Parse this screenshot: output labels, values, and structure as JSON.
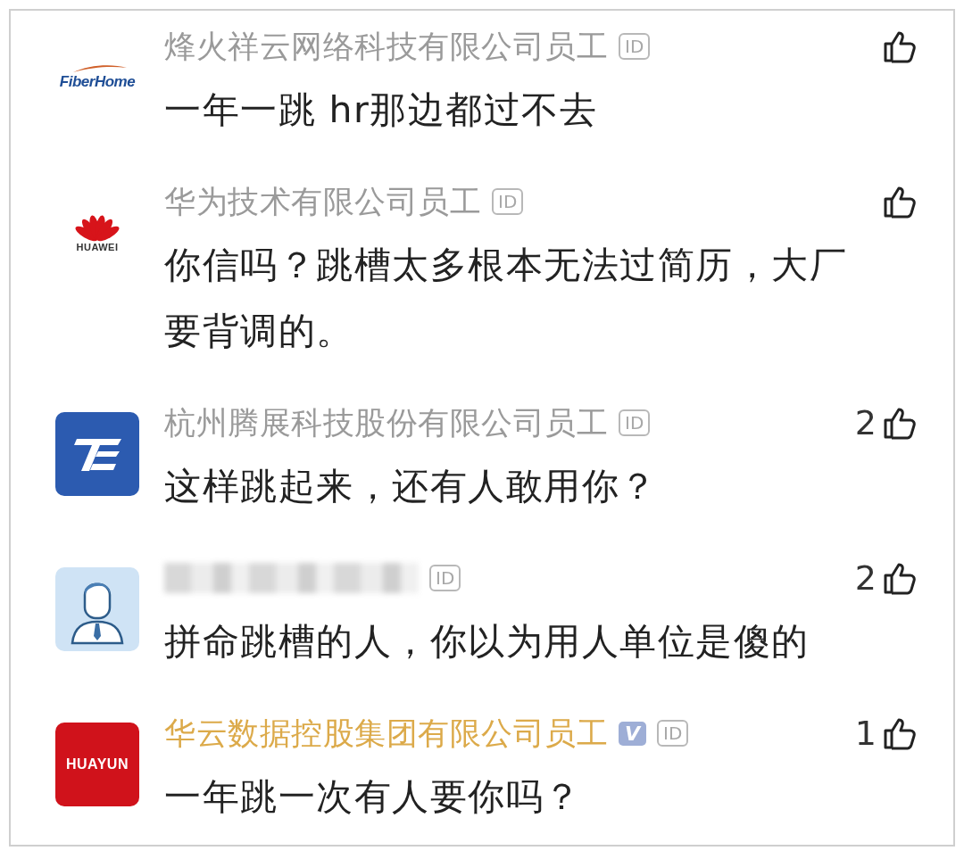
{
  "comments": [
    {
      "avatar": {
        "kind": "fiberhome",
        "text": "FiberHome"
      },
      "author": {
        "kind": "text",
        "name": "烽火祥云网络科技有限公司员工",
        "vip": false
      },
      "id_badge": "ID",
      "content": "一年一跳 hr那边都过不去"
    },
    {
      "avatar": {
        "kind": "huawei",
        "text": "HUAWEI"
      },
      "author": {
        "kind": "text",
        "name": "华为技术有限公司员工",
        "vip": false
      },
      "id_badge": "ID",
      "content": "你信吗？跳槽太多根本无法过简历，大厂要背调的。"
    },
    {
      "avatar": {
        "kind": "tz"
      },
      "author": {
        "kind": "text",
        "name": "杭州腾展科技股份有限公司员工",
        "vip": false
      },
      "id_badge": "ID",
      "likes": {
        "count": "2"
      },
      "content": "这样跳起来，还有人敢用你？"
    },
    {
      "avatar": {
        "kind": "person"
      },
      "author": {
        "kind": "blurred"
      },
      "id_badge": "ID",
      "likes": {
        "count": "2"
      },
      "content": "拼命跳槽的人，你以为用人单位是傻的"
    },
    {
      "avatar": {
        "kind": "huayun",
        "text": "HUAYUN"
      },
      "author": {
        "kind": "text",
        "name": "华云数据控股集团有限公司员工",
        "vip": true,
        "vip_badge": "V"
      },
      "id_badge": "ID",
      "likes": {
        "count": "1"
      },
      "content": "一年跳一次有人要你吗？"
    }
  ]
}
